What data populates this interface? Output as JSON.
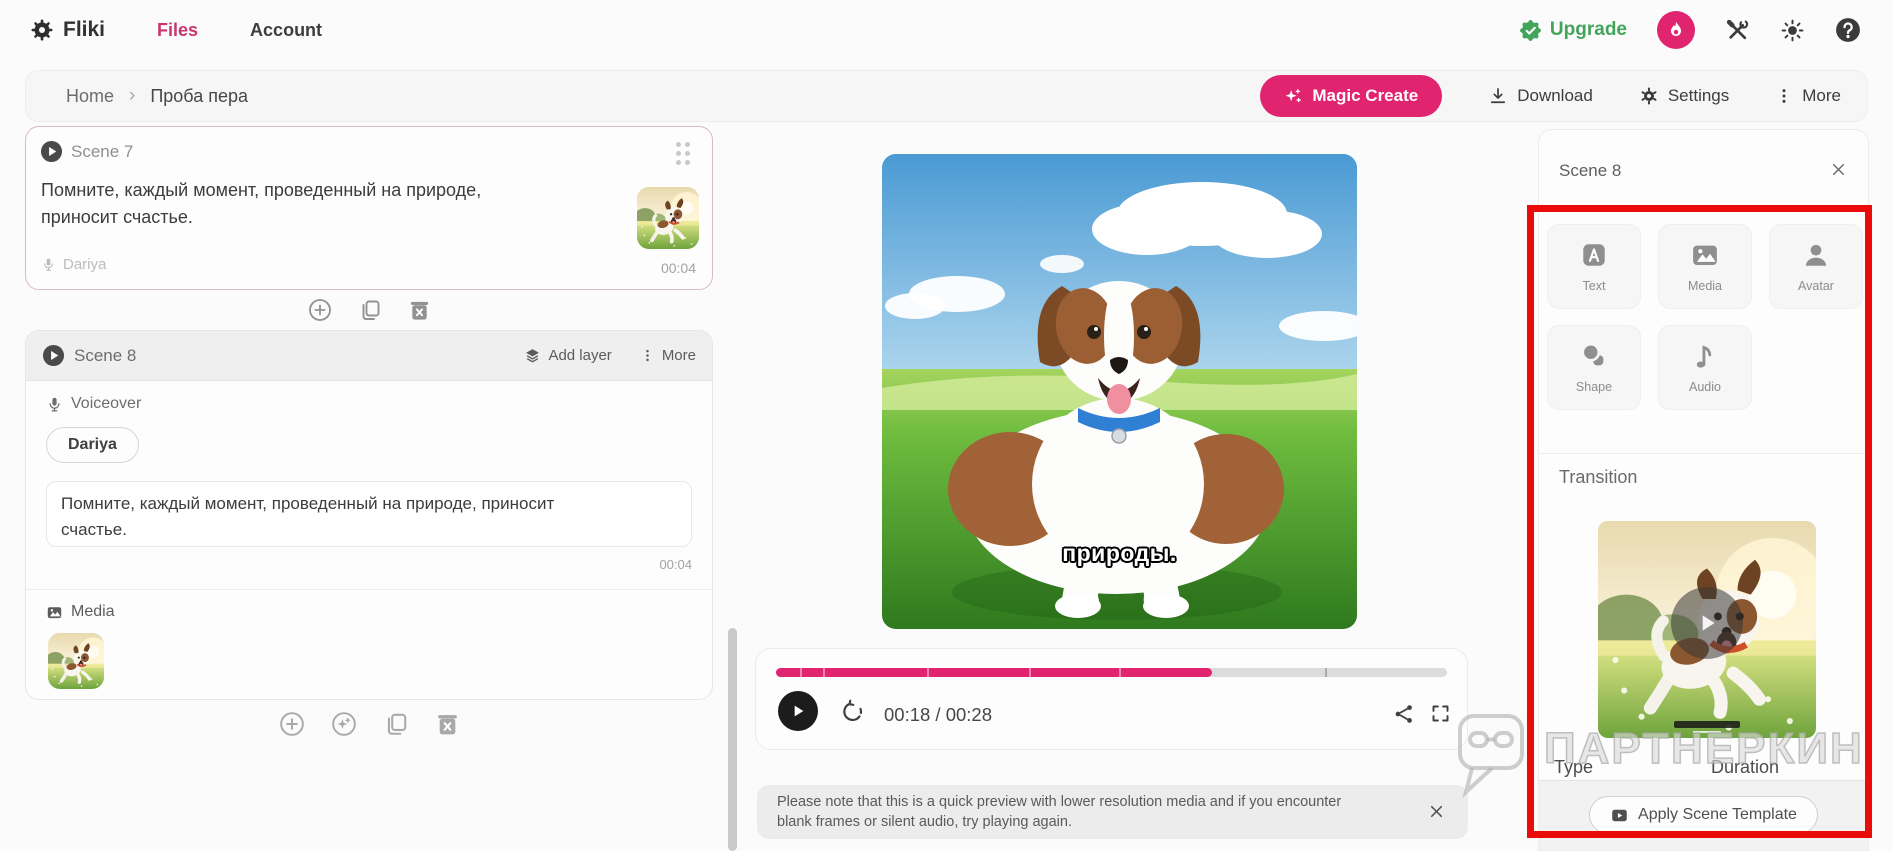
{
  "topnav": {
    "brand": "Fliki",
    "files_label": "Files",
    "account_label": "Account",
    "upgrade_label": "Upgrade"
  },
  "toolbar": {
    "breadcrumb_home": "Home",
    "breadcrumb_separator": "›",
    "breadcrumb_current": "Проба пера",
    "magic_create_label": "Magic Create",
    "download_label": "Download",
    "settings_label": "Settings",
    "more_label": "More"
  },
  "scene7": {
    "title": "Scene 7",
    "script_text": "Помните, каждый момент, проведенный на природе, приносит счастье.",
    "voice_name": "Dariya",
    "duration": "00:04"
  },
  "scene8": {
    "title": "Scene 8",
    "add_layer_label": "Add layer",
    "more_label": "More",
    "voiceover_label": "Voiceover",
    "voice_name": "Dariya",
    "script_text": "Помните, каждый момент, проведенный на природе, приносит счастье.",
    "duration": "00:04",
    "media_label": "Media"
  },
  "preview": {
    "caption": "природы."
  },
  "player": {
    "time_display": "00:18 / 00:28",
    "progress": {
      "percent": 65,
      "markers_percent": [
        3.7,
        7.2,
        22.7,
        37.9,
        51.2,
        82
      ]
    }
  },
  "notice": {
    "text": "Please note that this is a quick preview with lower resolution media and if you encounter blank frames or silent audio, try playing again."
  },
  "inspector": {
    "title": "Scene 8",
    "tools": [
      {
        "label": "Text"
      },
      {
        "label": "Media"
      },
      {
        "label": "Avatar"
      },
      {
        "label": "Shape"
      },
      {
        "label": "Audio"
      }
    ],
    "transition_label": "Transition",
    "type_label": "Type",
    "duration_label": "Duration",
    "apply_template_label": "Apply Scene Template"
  },
  "watermark": {
    "text": "ПАРТНЕРКИН"
  },
  "colors": {
    "accent_pink": "#e0246f",
    "upgrade_green": "#43a45c",
    "highlight_red": "#ea0b0b"
  }
}
